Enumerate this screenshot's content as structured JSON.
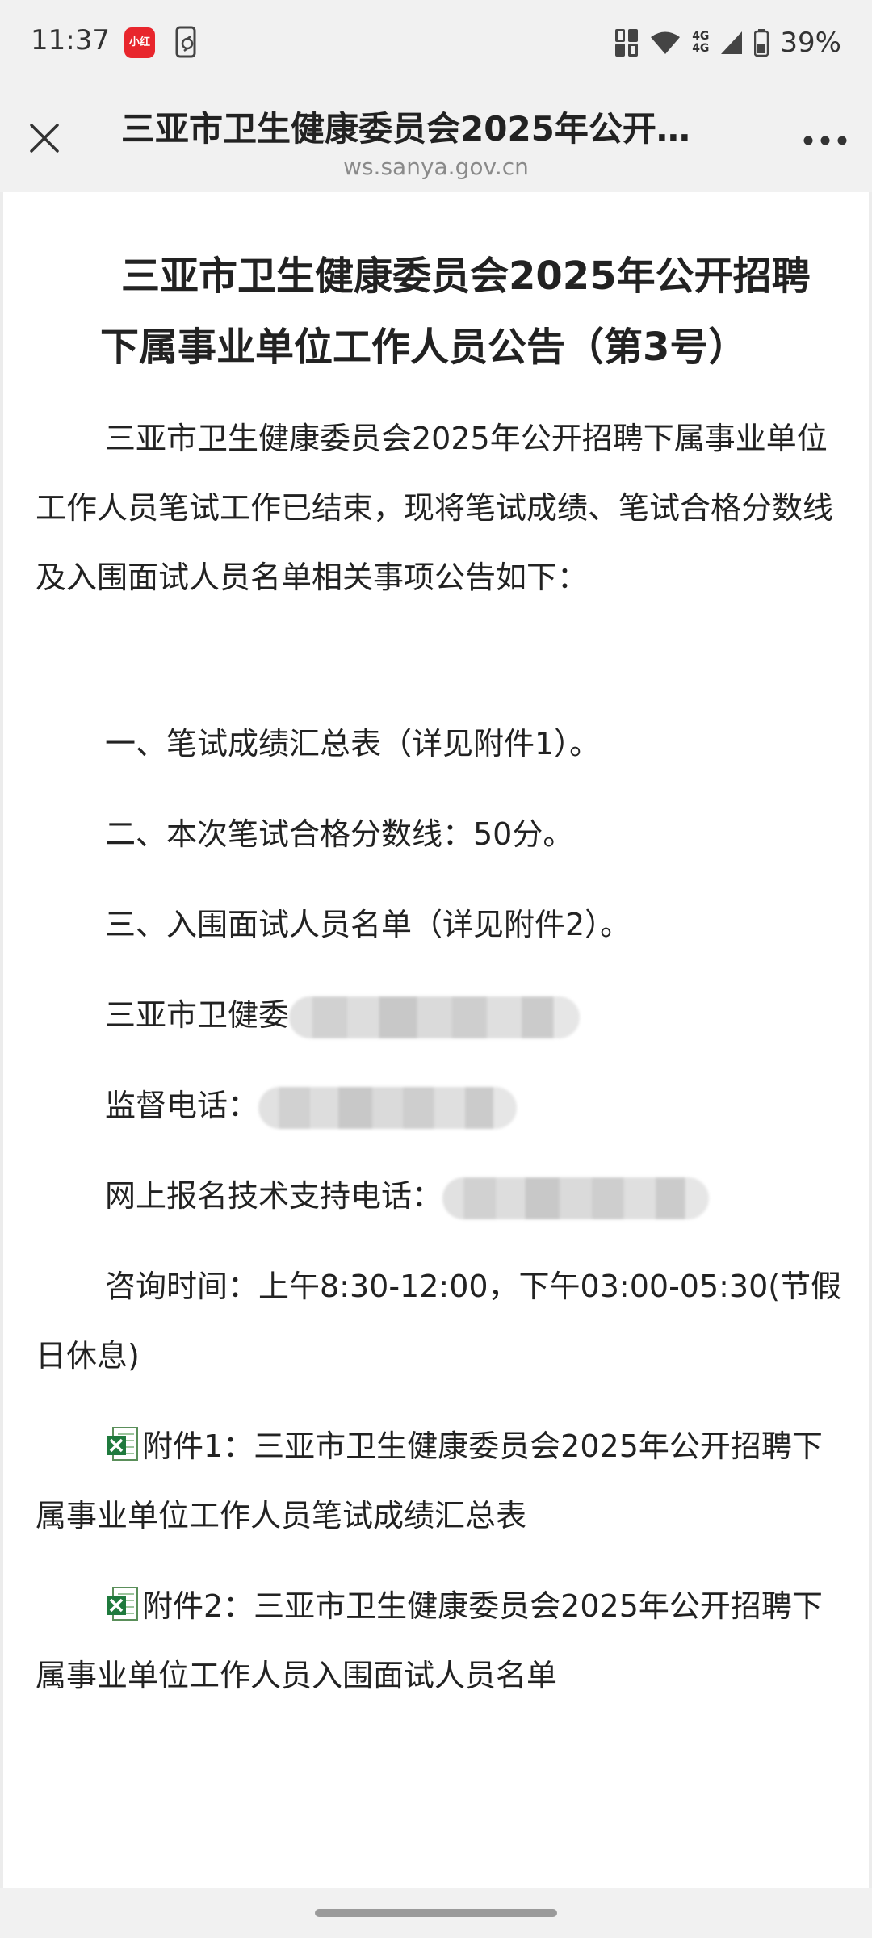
{
  "status_bar": {
    "time": "11:37",
    "notif_app_label": "小红书",
    "net_label_top": "4G",
    "net_label_bottom": "4G",
    "battery": "39%"
  },
  "title_bar": {
    "title": "三亚市卫生健康委员会2025年公开…",
    "domain": "ws.sanya.gov.cn"
  },
  "article": {
    "title": "三亚市卫生健康委员会2025年公开招聘下属事业单位工作人员公告（第3号）",
    "intro": "三亚市卫生健康委员会2025年公开招聘下属事业单位工作人员笔试工作已结束，现将笔试成绩、笔试合格分数线及入围面试人员名单相关事项公告如下：",
    "item1": "一、笔试成绩汇总表（详见附件1）。",
    "item2": "二、本次笔试合格分数线：50分。",
    "item3": "三、入围面试人员名单（详见附件2）。",
    "contact1_label": "三亚市卫健委",
    "contact2_label": "监督电话：",
    "contact3_label": "网上报名技术支持电话：",
    "hours": "咨询时间：上午8:30-12:00，下午03:00-05:30(节假日休息)",
    "attachment1": "附件1：三亚市卫生健康委员会2025年公开招聘下属事业单位工作人员笔试成绩汇总表",
    "attachment2": "附件2：三亚市卫生健康委员会2025年公开招聘下属事业单位工作人员入围面试人员名单"
  },
  "icons": {
    "close": "close-icon",
    "more": "more-icon",
    "attachment": "excel-file-icon"
  },
  "colors": {
    "background": "#f1f1f1",
    "content": "#ffffff",
    "text": "#222222",
    "muted": "#8a8a8a",
    "excel_green": "#1f7a3d"
  }
}
